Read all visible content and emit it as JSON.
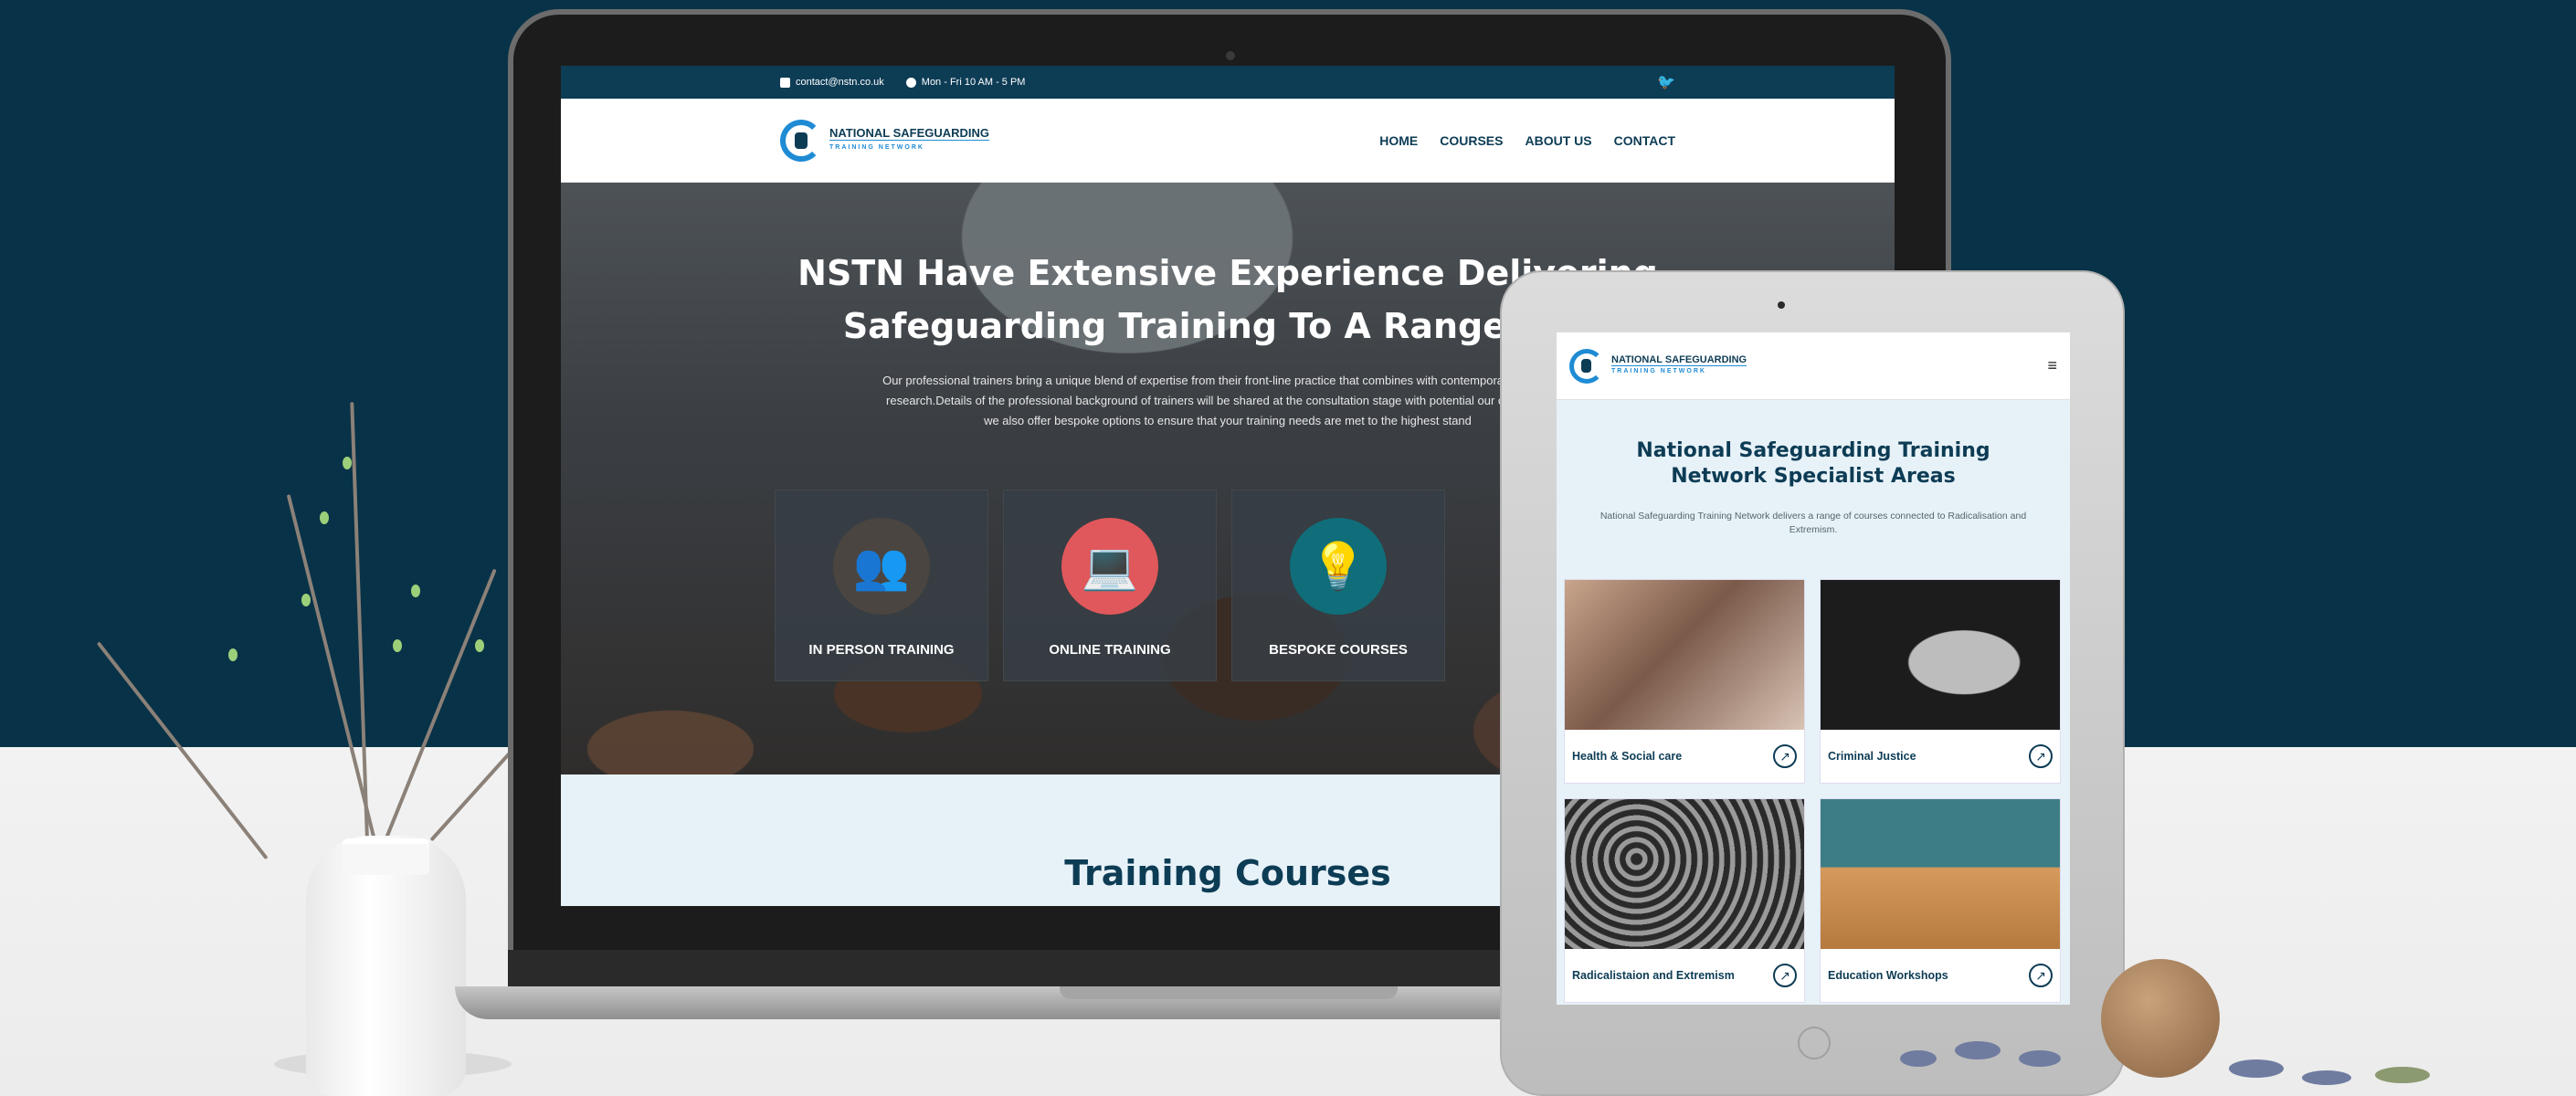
{
  "laptop_site": {
    "topbar": {
      "email": "contact@nstn.co.uk",
      "hours": "Mon - Fri 10 AM - 5 PM",
      "social_icon": "twitter-icon"
    },
    "logo": {
      "name": "NATIONAL SAFEGUARDING",
      "sub": "TRAINING NETWORK"
    },
    "nav": [
      "HOME",
      "COURSES",
      "ABOUT US",
      "CONTACT"
    ],
    "hero": {
      "heading_line1": "NSTN Have Extensive Experience Delivering",
      "heading_line2": "Safeguarding Training To A Range Of Cl",
      "paragraph": "Our professional trainers bring a unique blend of expertise from their front-line practice that combines with contemporary theory and research.Details of the professional background of trainers will be shared at the consultation stage with potential our core courses, we also offer bespoke options to ensure that your training needs are met to the highest stand"
    },
    "cards": [
      {
        "label": "IN PERSON TRAINING",
        "icon": "classroom-icon",
        "color": "#4a4540"
      },
      {
        "label": "ONLINE TRAINING",
        "icon": "laptop-user-icon",
        "color": "#e0585b"
      },
      {
        "label": "BESPOKE COURSES",
        "icon": "lightbulb-gear-icon",
        "color": "#0f6e7a"
      }
    ],
    "section_title": "Training Courses"
  },
  "tablet_site": {
    "logo": {
      "name": "NATIONAL SAFEGUARDING",
      "sub": "TRAINING NETWORK"
    },
    "menu_icon": "hamburger-icon",
    "title_line1": "National Safeguarding Training",
    "title_line2": "Network Specialist Areas",
    "description": "National Safeguarding Training Network delivers a range of courses connected to Radicalisation and Extremism.",
    "areas": [
      {
        "label": "Health & Social care",
        "photo": "#b79a86"
      },
      {
        "label": "Criminal Justice",
        "photo": "#2a2a2a"
      },
      {
        "label": "Radicalistaion and Extremism",
        "photo": "#6d6d6d"
      },
      {
        "label": "Education Workshops",
        "photo": "#8fb7c2"
      }
    ]
  },
  "colors": {
    "navy": "#0d3c55",
    "accent": "#1e8bd4",
    "background_top": "#083247"
  }
}
